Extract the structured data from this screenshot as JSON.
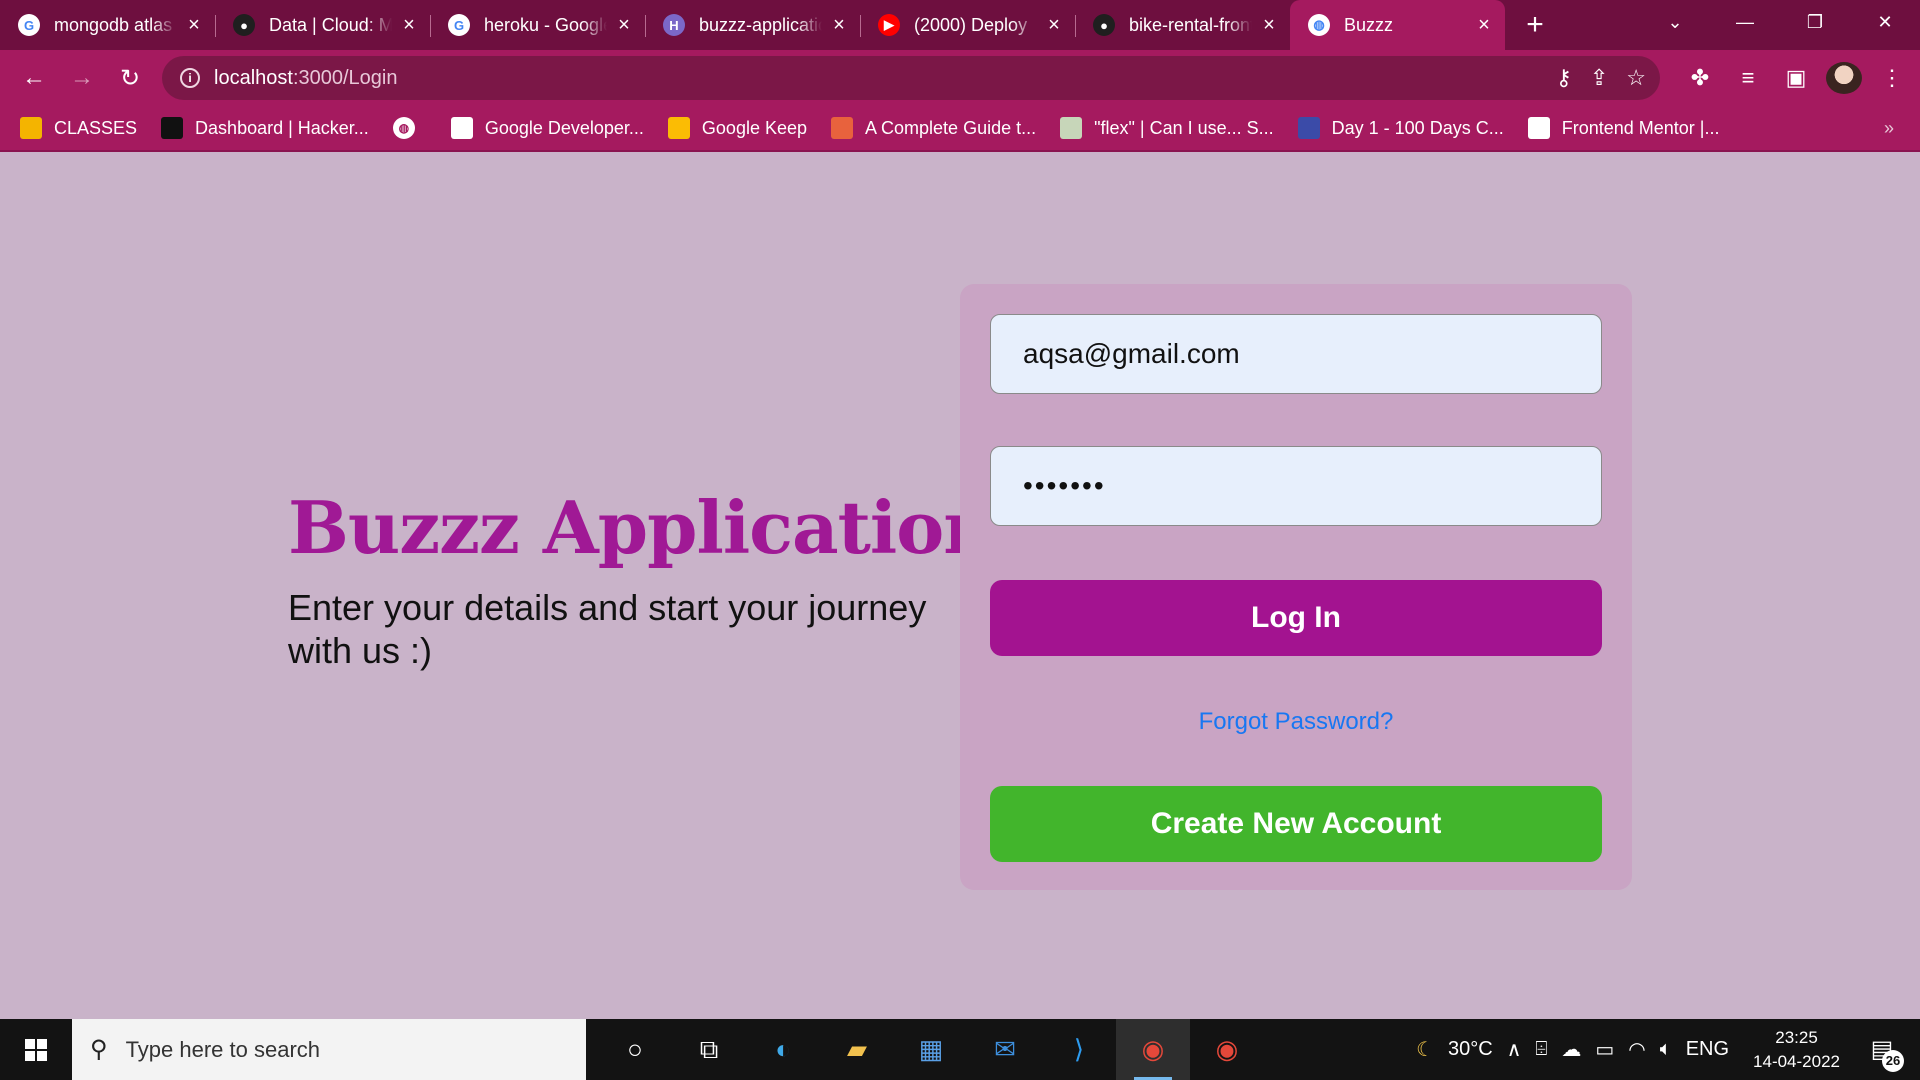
{
  "browser": {
    "tabs": [
      {
        "title": "mongodb atlas",
        "icon": "google-icon",
        "color": "#ffffff",
        "glyph": "G"
      },
      {
        "title": "Data | Cloud: MongoDB",
        "icon": "mongodb-leaf-icon",
        "color": "#1f1f1f",
        "glyph": "●"
      },
      {
        "title": "heroku - Google Search",
        "icon": "google-icon",
        "color": "#ffffff",
        "glyph": "G"
      },
      {
        "title": "buzzz-application",
        "icon": "heroku-icon",
        "color": "#7b68c8",
        "glyph": "H"
      },
      {
        "title": "(2000) Deploy",
        "icon": "youtube-icon",
        "color": "#ff0000",
        "glyph": "▶"
      },
      {
        "title": "bike-rental-frontend",
        "icon": "github-icon",
        "color": "#1f1f1f",
        "glyph": "●"
      },
      {
        "title": "Buzzz",
        "icon": "globe-icon",
        "color": "#ffffff",
        "glyph": "◍",
        "active": true
      }
    ],
    "address": {
      "host": "localhost",
      "path": ":3000/Login"
    },
    "bookmarks": [
      {
        "label": "CLASSES",
        "icon": "classroom-icon",
        "color": "#f4b400"
      },
      {
        "label": "Dashboard | Hacker...",
        "icon": "hackerrank-icon",
        "color": "#111111"
      },
      {
        "label": "",
        "icon": "globe-icon",
        "color": "#ffffff"
      },
      {
        "label": "Google Developer...",
        "icon": "google-developers-icon",
        "color": "#ffffff"
      },
      {
        "label": "Google Keep",
        "icon": "keep-icon",
        "color": "#fbbc04"
      },
      {
        "label": "A Complete Guide t...",
        "icon": "css-tricks-icon",
        "color": "#e8623d"
      },
      {
        "label": "\"flex\" | Can I use... S...",
        "icon": "caniuse-icon",
        "color": "#c7d6b9"
      },
      {
        "label": "Day 1 - 100 Days C...",
        "icon": "course-icon",
        "color": "#3b4ba8"
      },
      {
        "label": "Frontend Mentor |...",
        "icon": "frontend-mentor-icon",
        "color": "#ffffff"
      }
    ]
  },
  "page": {
    "title": "Buzzz Application",
    "tagline": "Enter your details and start your journey with us :)",
    "form": {
      "email": "aqsa@gmail.com",
      "password_masked": "•••••••",
      "login_label": "Log In",
      "forgot_label": "Forgot Password?",
      "create_label": "Create New Account"
    }
  },
  "taskbar": {
    "search_placeholder": "Type here to search",
    "weather": "30°C",
    "language": "ENG",
    "time": "23:25",
    "date": "14-04-2022",
    "notifications": "26"
  },
  "colors": {
    "brand": "#a01995",
    "login_button": "#a31390",
    "create_button": "#42b52c",
    "link": "#1877f2",
    "page_bg": "#c9b3c9",
    "browser_theme": "#a51a5f"
  }
}
